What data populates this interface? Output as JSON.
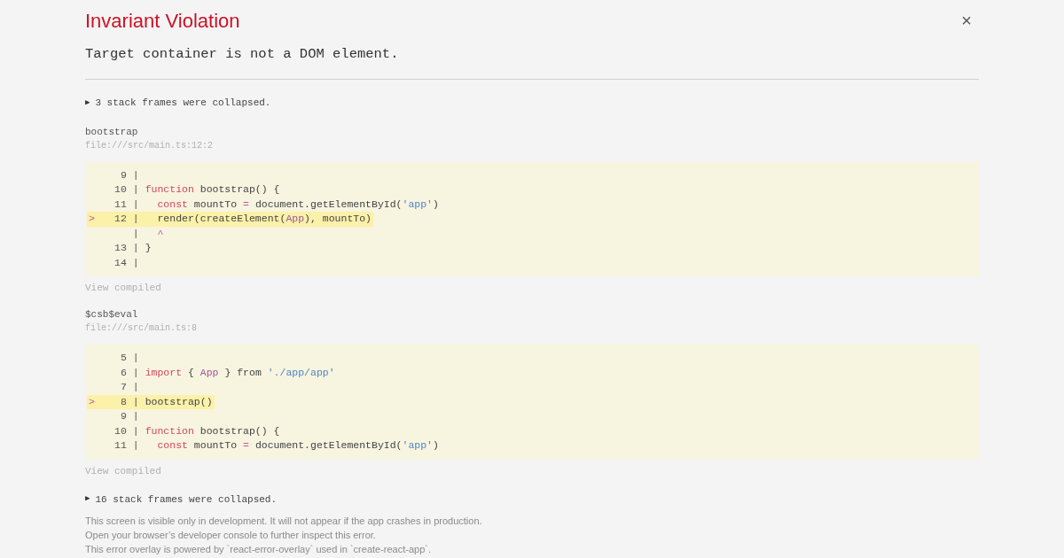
{
  "title": "Invariant Violation",
  "close": "×",
  "message": "Target container is not a DOM element.",
  "sections": [
    {
      "kind": "collapsed",
      "toggle": "▶",
      "text": "3 stack frames were collapsed."
    },
    {
      "kind": "frame",
      "name": "bootstrap",
      "location": "file:///src/main.ts:12:2",
      "link": "View compiled",
      "lines": [
        {
          "number": "9",
          "separator": "|",
          "highlighted": false
        },
        {
          "number": "10",
          "separator": "|",
          "highlighted": false,
          "tokens": [
            {
              "kind": "keyword",
              "text": "function"
            },
            {
              "kind": "plain",
              "text": " bootstrap() {"
            }
          ]
        },
        {
          "number": "11",
          "separator": "|",
          "highlighted": false,
          "indented": true,
          "tokens": [
            {
              "kind": "keyword",
              "text": "const"
            },
            {
              "kind": "plain",
              "text": " mountTo "
            },
            {
              "kind": "operator",
              "text": "="
            },
            {
              "kind": "plain",
              "text": " document.getElementById("
            },
            {
              "kind": "string",
              "text": "'app'"
            },
            {
              "kind": "plain",
              "text": ")"
            }
          ]
        },
        {
          "marker": ">",
          "number": "12",
          "separator": "|",
          "highlighted": true,
          "indented": true,
          "tokens": [
            {
              "kind": "plain",
              "text": "render(createElement("
            },
            {
              "kind": "component",
              "text": "App"
            },
            {
              "kind": "plain",
              "text": "), mountTo)"
            }
          ]
        },
        {
          "separator": "|",
          "highlighted": false,
          "indented": true,
          "tokens": [
            {
              "kind": "operator",
              "text": "^"
            }
          ]
        },
        {
          "number": "13",
          "separator": "|",
          "highlighted": false,
          "tokens": [
            {
              "kind": "plain",
              "text": "}"
            }
          ]
        },
        {
          "number": "14",
          "separator": "|",
          "highlighted": false
        }
      ]
    },
    {
      "kind": "frame",
      "name": "$csb$eval",
      "location": "file:///src/main.ts:8",
      "link": "View compiled",
      "lines": [
        {
          "number": "5",
          "separator": "|",
          "highlighted": false
        },
        {
          "number": "6",
          "separator": "|",
          "highlighted": false,
          "tokens": [
            {
              "kind": "keyword",
              "text": "import"
            },
            {
              "kind": "plain",
              "text": " { "
            },
            {
              "kind": "component",
              "text": "App"
            },
            {
              "kind": "plain",
              "text": " } from "
            },
            {
              "kind": "string",
              "text": "'./app/app'"
            }
          ]
        },
        {
          "number": "7",
          "separator": "|",
          "highlighted": false
        },
        {
          "marker": ">",
          "number": "8",
          "separator": "|",
          "highlighted": true,
          "tokens": [
            {
              "kind": "plain",
              "text": "bootstrap()"
            }
          ]
        },
        {
          "number": "9",
          "separator": "|",
          "highlighted": false
        },
        {
          "number": "10",
          "separator": "|",
          "highlighted": false,
          "tokens": [
            {
              "kind": "keyword",
              "text": "function"
            },
            {
              "kind": "plain",
              "text": " bootstrap() {"
            }
          ]
        },
        {
          "number": "11",
          "separator": "|",
          "highlighted": false,
          "indented": true,
          "tokens": [
            {
              "kind": "keyword",
              "text": "const"
            },
            {
              "kind": "plain",
              "text": " mountTo "
            },
            {
              "kind": "operator",
              "text": "="
            },
            {
              "kind": "plain",
              "text": " document.getElementById("
            },
            {
              "kind": "string",
              "text": "'app'"
            },
            {
              "kind": "plain",
              "text": ")"
            }
          ]
        }
      ]
    },
    {
      "kind": "collapsed",
      "toggle": "▶",
      "text": "16 stack frames were collapsed."
    }
  ],
  "footer": [
    "This screen is visible only in development. It will not appear if the app crashes in production.",
    "Open your browser’s developer console to further inspect this error.",
    "This error overlay is powered by `react-error-overlay` used in `create-react-app`."
  ]
}
